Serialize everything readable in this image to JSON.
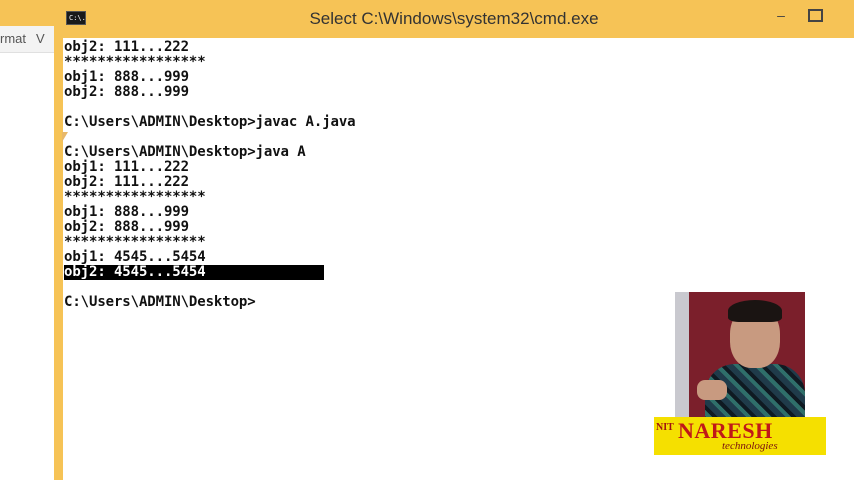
{
  "background_window": {
    "menu_items": [
      "rmat",
      "V"
    ]
  },
  "cmd": {
    "title": "Select C:\\Windows\\system32\\cmd.exe",
    "icon_label": "C:\\.",
    "minimize_glyph": "‒",
    "console_lines": [
      "obj2: 111...222",
      "*****************",
      "obj1: 888...999",
      "obj2: 888...999",
      "",
      "C:\\Users\\ADMIN\\Desktop>javac A.java",
      "",
      "C:\\Users\\ADMIN\\Desktop>java A",
      "obj1: 111...222",
      "obj2: 111...222",
      "*****************",
      "obj1: 888...999",
      "obj2: 888...999",
      "*****************",
      "obj1: 4545...5454",
      "obj2: 4545...5454",
      "",
      "C:\\Users\\ADMIN\\Desktop>"
    ],
    "selected_line_index": 15
  },
  "logo": {
    "mark": "NIT",
    "name": "NARESH",
    "tagline": "technologies"
  },
  "colors": {
    "titlebar": "#f6c356",
    "console_bg": "#ffffff",
    "console_text": "#111111",
    "logo_bg": "#f5e000",
    "logo_text": "#c01818"
  }
}
